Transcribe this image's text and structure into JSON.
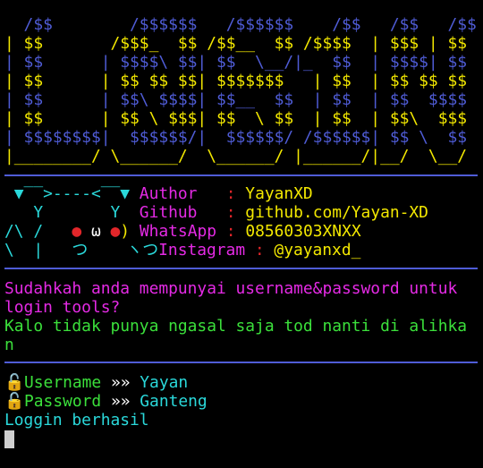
{
  "banner": [
    {
      "row": 0,
      "text": "  /$$        /$$$$$$   /$$$$$$    /$$   /$$   /$$"
    },
    {
      "row": 1,
      "text": "| $$       /$$$_  $$ /$$__  $$ /$$$$  | $$$ | $$"
    },
    {
      "row": 2,
      "text": "| $$      | $$$$\\ $$| $$  \\__/|_  $$  | $$$$| $$"
    },
    {
      "row": 3,
      "text": "| $$      | $$ $$ $$| $$$$$$$   | $$  | $$ $$ $$"
    },
    {
      "row": 4,
      "text": "| $$      | $$\\ $$$$| $$__  $$  | $$  | $$  $$$$"
    },
    {
      "row": 5,
      "text": "| $$      | $$ \\ $$$| $$  \\ $$  | $$  | $$\\  $$$"
    },
    {
      "row": 6,
      "text": "| $$$$$$$$|  $$$$$$/|  $$$$$$/ /$$$$$$| $$ \\  $$"
    },
    {
      "row": 7,
      "text": "|________/ \\______/  \\______/ |______/|__/  \\__/"
    }
  ],
  "mascot": {
    "row1": " ▼‾‾>-‐-‐<‾‾▼ ",
    "row2": "   Y       Y  ",
    "row3a": "/\\ /   ",
    "row3_eye1": "●",
    "row3_mouth": " ω ",
    "row3_eye2": "●",
    "row3b": ") ",
    "row4": "\\  |   つ    ヽつ"
  },
  "info": {
    "author_label": "Author   ",
    "author_sep": ":",
    "author_value": " YayanXD",
    "github_label": "Github   ",
    "github_sep": ":",
    "github_value": " github.com/Yayan-XD",
    "whatsapp_label": "WhatsApp ",
    "whatsapp_sep": ":",
    "whatsapp_value": " 08560303XNXX",
    "instagram_label": "Instagram ",
    "instagram_sep": ":",
    "instagram_value": " @yayanxd_"
  },
  "prompt": {
    "question_line1": "Sudahkah anda mempunyai username&password untuk",
    "question_line2": "login tools?",
    "warning_line1": "Kalo tidak punya ngasal saja tod nanti di alihka",
    "warning_line2": "n"
  },
  "login": {
    "lock_glyph": "🔓",
    "username_label": "Username",
    "username_arrow": "»»",
    "username_value": "Yayan",
    "password_label": "Password",
    "password_arrow": "»»",
    "password_value": "Ganteng",
    "result": "Loggin berhasil"
  },
  "colors": {
    "background": "#000000",
    "banner_yellow": "#f3e800",
    "banner_blue": "#4f5cd6",
    "magenta": "#e52ae5",
    "green": "#3be03b",
    "cyan": "#2ad8da",
    "red": "#e2262a"
  }
}
